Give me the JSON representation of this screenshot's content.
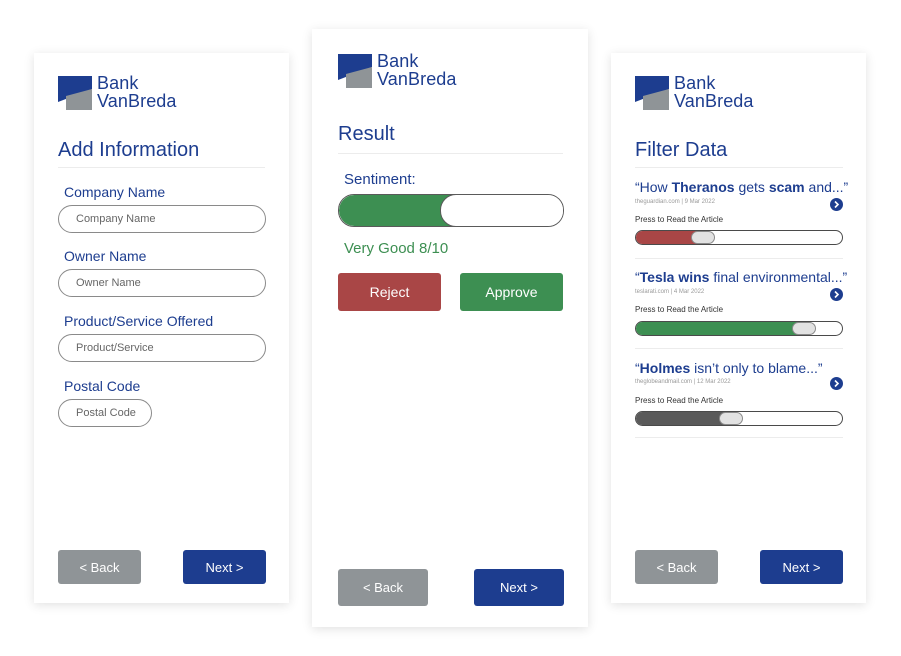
{
  "brand": {
    "line1": "Bank",
    "line2": "VanBreda",
    "colors": {
      "navy": "#1d3d8f",
      "gray": "#8f9497"
    }
  },
  "add_info": {
    "title": "Add Information",
    "fields": [
      {
        "label": "Company Name",
        "placeholder": "Company Name"
      },
      {
        "label": "Owner Name",
        "placeholder": "Owner Name"
      },
      {
        "label": "Product/Service Offered",
        "placeholder": "Product/Service"
      },
      {
        "label": "Postal Code",
        "placeholder": "Postal Code"
      }
    ],
    "back_label": "< Back",
    "next_label": "Next >"
  },
  "result": {
    "title": "Result",
    "sentiment_label": "Sentiment:",
    "sentiment_level": 0.7,
    "sentiment_color": "#3d8f52",
    "rating_text": "Very Good 8/10",
    "reject_label": "Reject",
    "approve_label": "Approve",
    "reject_color": "#a94646",
    "approve_color": "#3d8f52",
    "back_label": "< Back",
    "next_label": "Next >"
  },
  "filter": {
    "title": "Filter Data",
    "articles": [
      {
        "q_open": "“How ",
        "bold": "Theranos",
        "rest": " gets ",
        "bold2": "scam",
        "tail": " and...”",
        "source": "theguardian.com | 9 Mar 2022",
        "press": "Press to Read the Article",
        "level": 0.3,
        "color": "#a94646"
      },
      {
        "q_open": "“",
        "bold": "Tesla wins",
        "rest": " final environmental...”",
        "bold2": "",
        "tail": "",
        "source": "teslarati.com | 4 Mar 2022",
        "press": "Press to Read the Article",
        "level": 0.85,
        "color": "#3d8f52"
      },
      {
        "q_open": "“",
        "bold": "Holmes",
        "rest": " isn’t only to blame...”",
        "bold2": "",
        "tail": "",
        "source": "theglobeandmail.com | 12 Mar 2022",
        "press": "Press to Read the Article",
        "level": 0.45,
        "color": "#5a5a5a"
      }
    ],
    "back_label": "< Back",
    "next_label": "Next >"
  }
}
